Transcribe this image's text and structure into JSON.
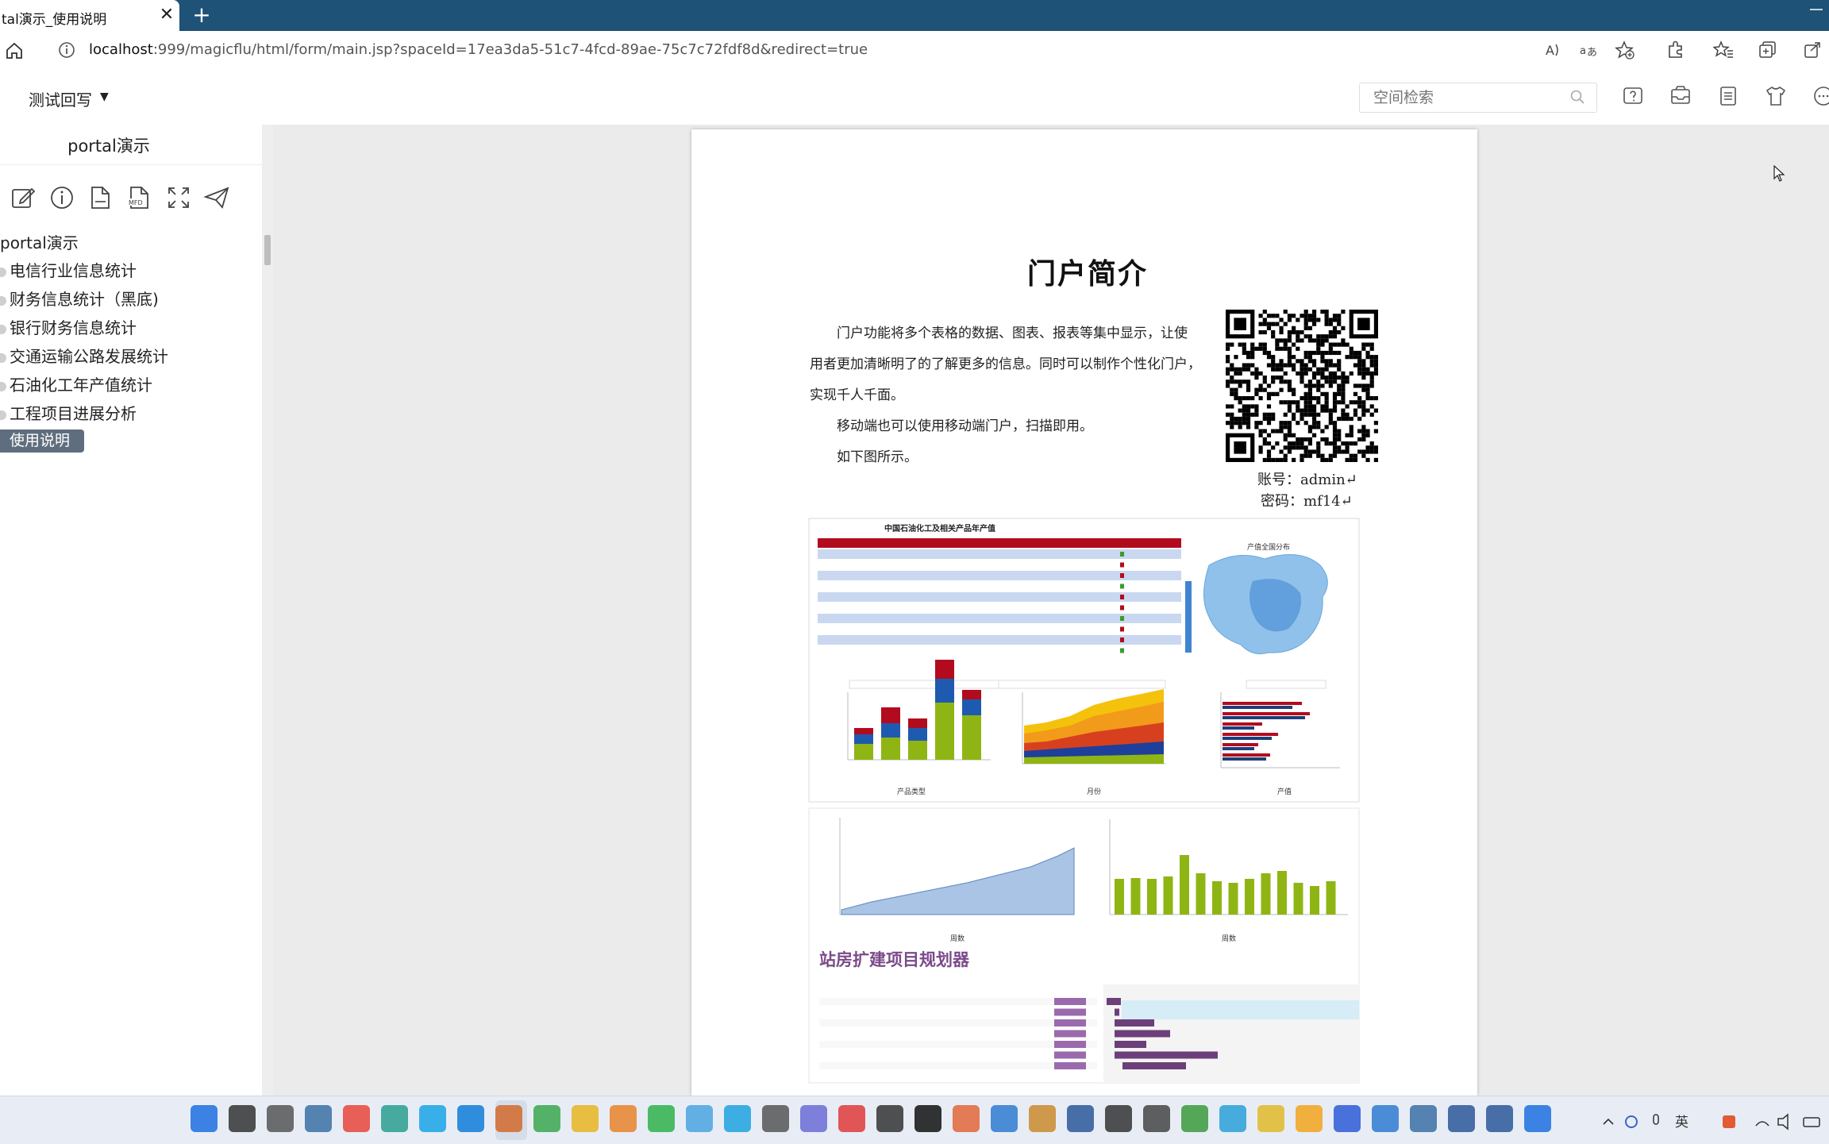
{
  "browser": {
    "tab_title": "tal演示_使用说明",
    "tab_close": "✕",
    "new_tab": "+",
    "url_host": "localhost",
    "url_rest": ":999/magicflu/html/form/main.jsp?spaceId=17ea3da5-51c7-4fcd-89ae-75c7c72fdf8d&redirect=true",
    "toolbar_icons": [
      "read-aloud-icon",
      "translate-icon",
      "favorite-add-icon",
      "extensions-icon",
      "favorites-icon",
      "collections-icon",
      "share-icon"
    ]
  },
  "header": {
    "space_title": "测试回写",
    "caret": "▼",
    "search_placeholder": "空间检索",
    "icons": [
      "help-icon",
      "inbox-icon",
      "document-icon",
      "tshirt-icon",
      "more-icon"
    ]
  },
  "sidebar": {
    "title": "portal演示",
    "toolbar_icons": [
      "edit-icon",
      "info-icon",
      "file-icon",
      "mfd-file-icon",
      "fullscreen-icon",
      "send-icon"
    ],
    "tree_root": "portal演示",
    "items": [
      {
        "label": "电信行业信息统计"
      },
      {
        "label": "财务信息统计（黑底)"
      },
      {
        "label": "银行财务信息统计"
      },
      {
        "label": "交通运输公路发展统计"
      },
      {
        "label": "石油化工年产值统计"
      },
      {
        "label": "工程项目进展分析"
      }
    ],
    "active_item": "使用说明"
  },
  "document": {
    "title": "门户简介",
    "para1_line1": "门户功能将多个表格的数据、图表、报表等集中显示，让使",
    "para1_line2": "用者更加清晰明了的了解更多的信息。同时可以制作个性化门户，",
    "para1_line3": "实现千人千面。",
    "para2": "移动端也可以使用移动端门户，扫描即用。",
    "para3": "如下图所示。",
    "account": "账号：admin↵",
    "password": "密码：mf14↵",
    "image": {
      "table_title": "中国石油化工及相关产品年产值",
      "map_title": "产值全国分布",
      "axis_product_type": "产品类型",
      "axis_month": "月份",
      "axis_output": "产值",
      "axis_weeks": "周数",
      "gantt_title": "站房扩建项目规划器"
    }
  },
  "taskbar": {
    "icons": [
      "windows-start-icon",
      "search-icon",
      "task-view-icon",
      "app-icon",
      "chrome-icon",
      "app-icon",
      "app-icon",
      "edge-icon",
      "app-icon",
      "app-icon",
      "file-explorer-icon",
      "app-icon",
      "wechat-icon",
      "app-icon",
      "app-icon",
      "app-icon",
      "app-icon",
      "app-icon",
      "app-icon",
      "qq-icon",
      "app-icon",
      "app-icon",
      "app-icon",
      "word-icon",
      "app-icon",
      "app-icon",
      "app-icon",
      "app-icon",
      "app-icon",
      "app-icon",
      "app-icon",
      "app-icon",
      "app-icon",
      "app-icon",
      "app-icon",
      "app-icon"
    ],
    "tray_ime": "英"
  },
  "colors": {
    "titlebar": "#1e5276",
    "active_item": "#5f6e7e",
    "content_bg": "#ebebeb",
    "chart_red": "#b30b1e",
    "chart_green": "#8fb514",
    "gantt_purple": "#7b4a8a"
  }
}
